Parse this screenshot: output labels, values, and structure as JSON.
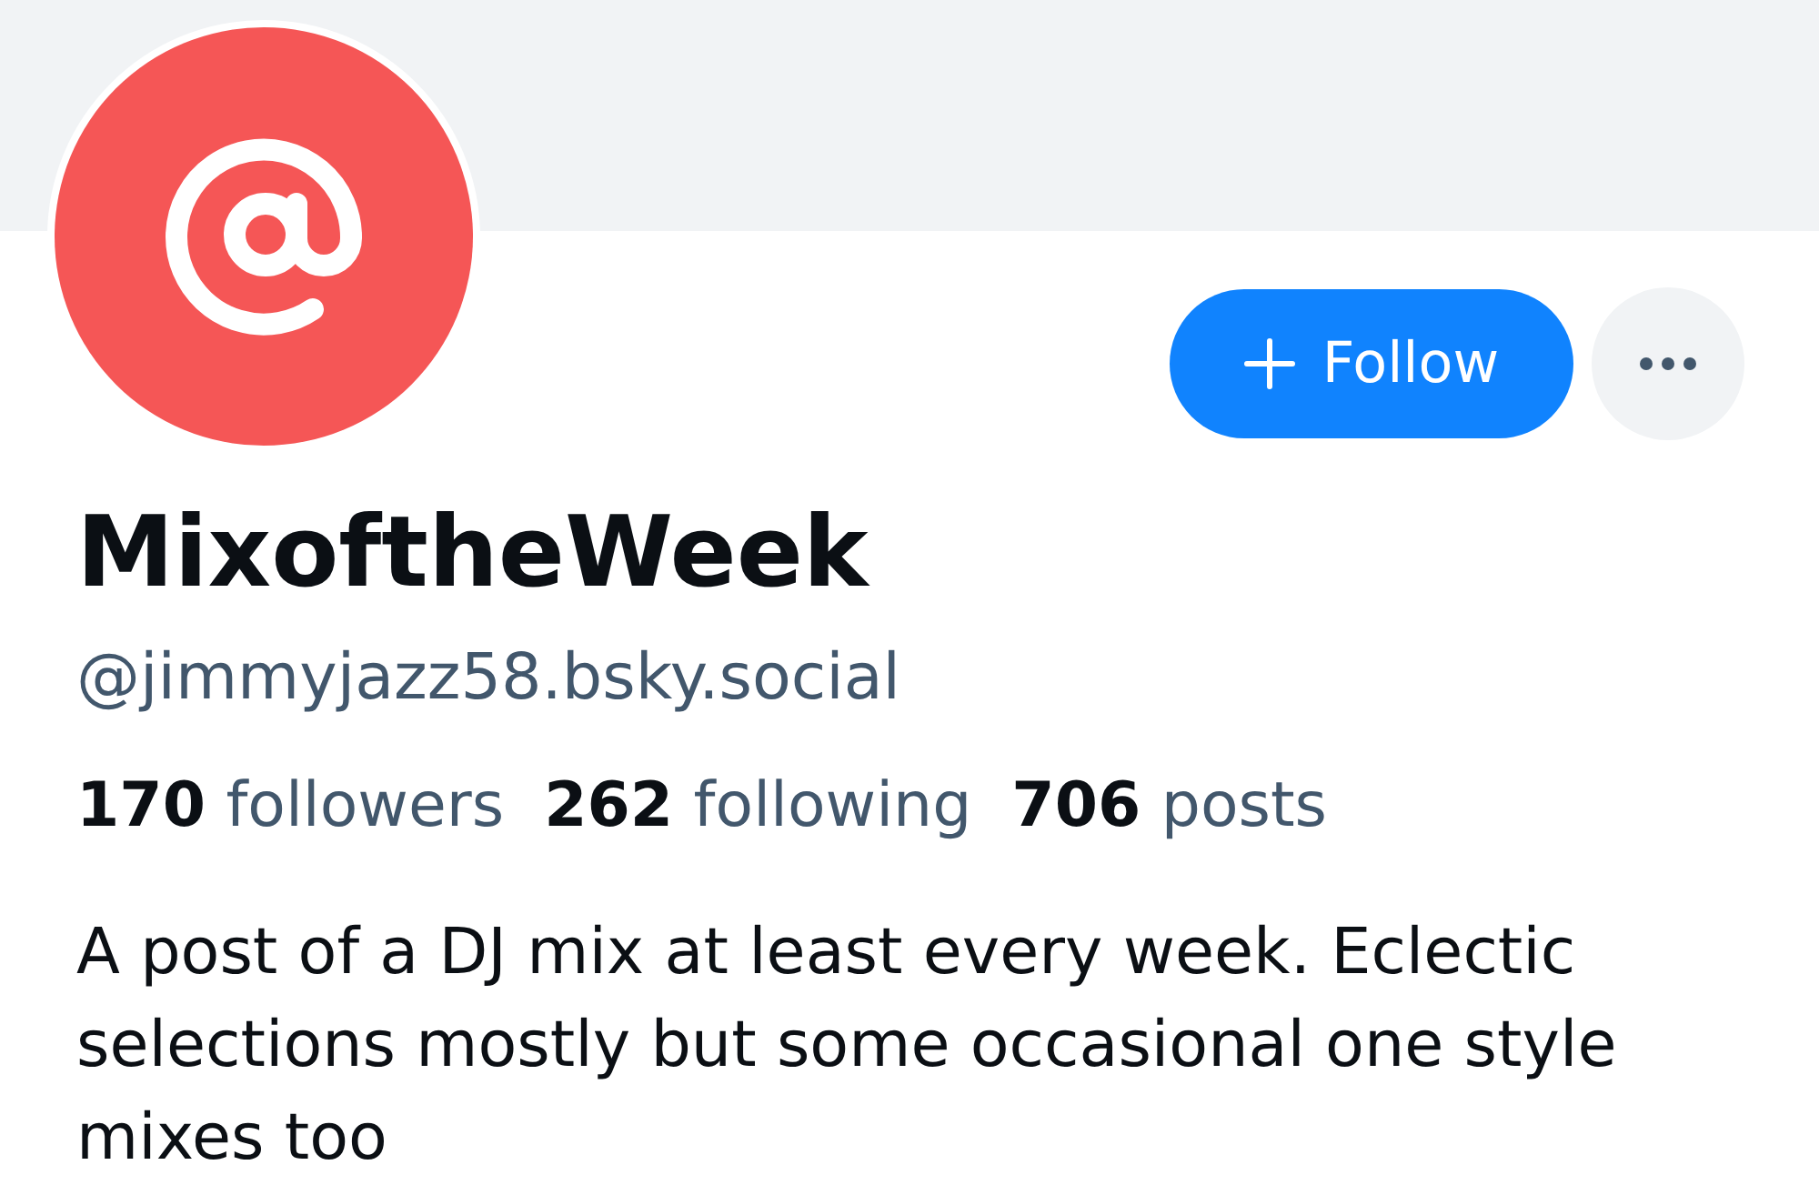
{
  "actions": {
    "follow_button": {
      "label": "Follow"
    }
  },
  "profile": {
    "display_name": "MixoftheWeek",
    "handle": "@jimmyjazz58.bsky.social"
  },
  "stats": [
    {
      "count": "170",
      "label": "followers"
    },
    {
      "count": "262",
      "label": "following"
    },
    {
      "count": "706",
      "label": "posts"
    }
  ],
  "bio": "A post of a DJ mix at least every week. Eclectic selections mostly but some occasional one style mixes too"
}
